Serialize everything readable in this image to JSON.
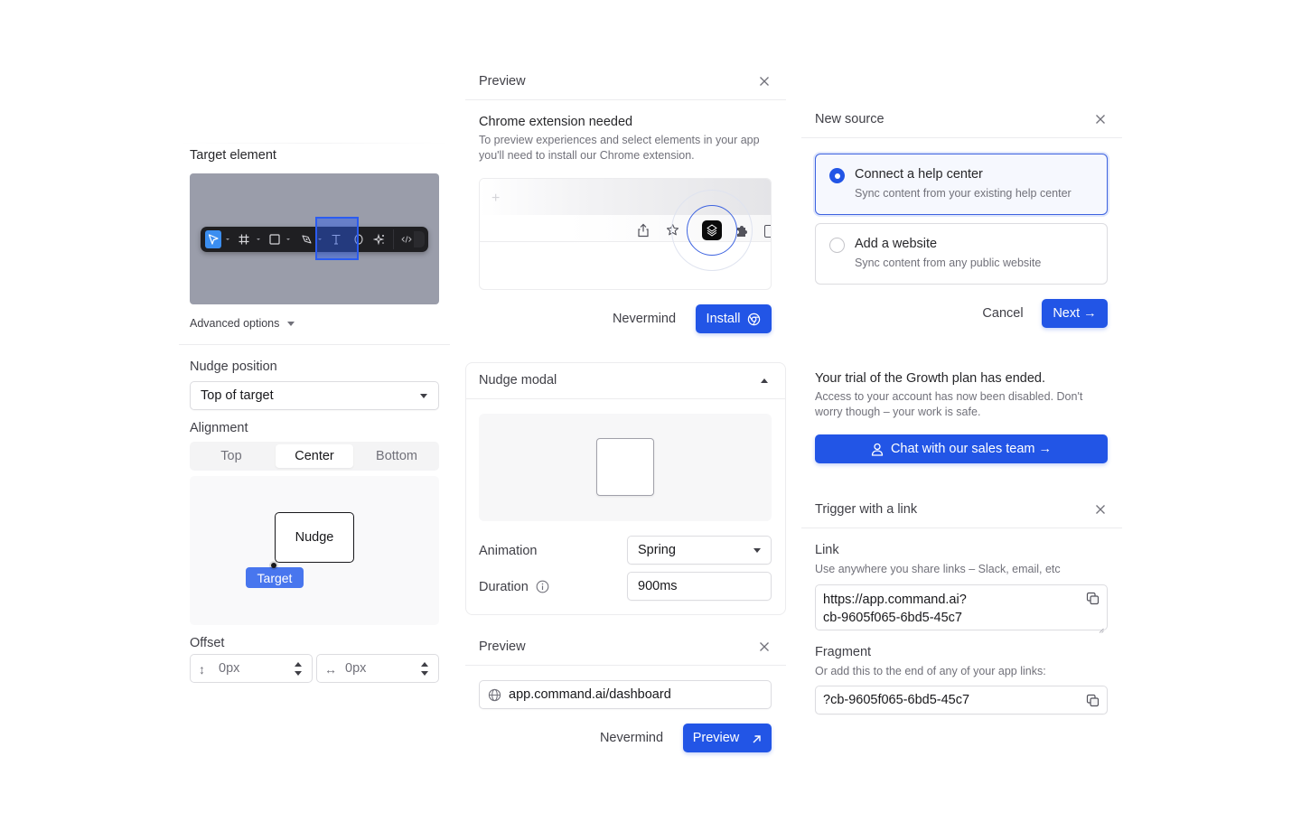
{
  "accent_color": "#2255e6",
  "left_panel": {
    "target_element": {
      "label": "Target element",
      "toolbar_icons": [
        "pointer-icon",
        "frame-icon",
        "rectangle-icon",
        "pen-icon",
        "text-icon",
        "ellipse-icon",
        "sparkle-icon",
        "code-icon"
      ]
    },
    "advanced_options_label": "Advanced options",
    "nudge_position": {
      "label": "Nudge position",
      "selected": "Top of target"
    },
    "alignment": {
      "label": "Alignment",
      "options": [
        "Top",
        "Center",
        "Bottom"
      ],
      "selected": "Center"
    },
    "diagram": {
      "nudge_label": "Nudge",
      "target_label": "Target"
    },
    "offset": {
      "label": "Offset",
      "vertical_value": "0px",
      "horizontal_value": "0px"
    }
  },
  "chrome_preview": {
    "header_title": "Preview",
    "heading": "Chrome extension needed",
    "description": "To preview experiences and select elements in your app you'll need to install our Chrome extension.",
    "nevermind_label": "Nevermind",
    "install_label": "Install"
  },
  "nudge_modal": {
    "header_title": "Nudge modal",
    "animation_label": "Animation",
    "animation_value": "Spring",
    "duration_label": "Duration",
    "duration_value": "900ms"
  },
  "url_preview": {
    "header_title": "Preview",
    "url_value": "app.command.ai/dashboard",
    "nevermind_label": "Nevermind",
    "preview_label": "Preview"
  },
  "new_source": {
    "header_title": "New source",
    "options": [
      {
        "title": "Connect a help center",
        "description": "Sync content from your existing help center",
        "selected": true
      },
      {
        "title": "Add a website",
        "description": "Sync content from any public website",
        "selected": false
      }
    ],
    "cancel_label": "Cancel",
    "next_label": "Next →"
  },
  "trial_ended": {
    "heading": "Your trial of the Growth plan has ended.",
    "description": "Access to your account has now been disabled. Don't worry though – your work is safe.",
    "cta_label": "Chat with our sales team →"
  },
  "trigger_link": {
    "header_title": "Trigger with a link",
    "link_label": "Link",
    "link_hint": "Use anywhere you share links – Slack, email, etc",
    "link_value": "https://app.command.ai?\ncb-9605f065-6bd5-45c7",
    "fragment_label": "Fragment",
    "fragment_hint": "Or add this to the end of any of your app links:",
    "fragment_value": "?cb-9605f065-6bd5-45c7"
  }
}
